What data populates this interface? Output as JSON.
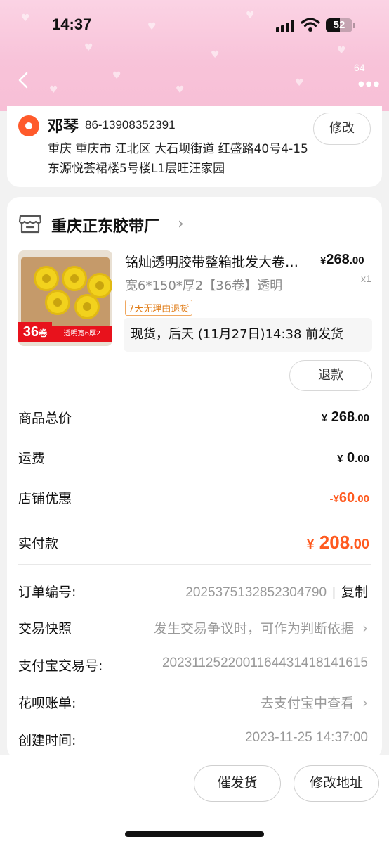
{
  "status_bar": {
    "time": "14:37",
    "battery": "52"
  },
  "header": {
    "more_badge": "64"
  },
  "address": {
    "name": "邓琴",
    "phone": "86-13908352391",
    "detail": "重庆 重庆市 江北区 大石坝街道 红盛路40号4-15东源悦荟裙楼5号楼L1层旺汪家园",
    "modify_label": "修改"
  },
  "store": {
    "name": "重庆正东胶带厂"
  },
  "product": {
    "title": "铭灿透明胶带整箱批发大卷宽胶带",
    "price_currency": "¥",
    "price_int": "268",
    "price_dec": ".00",
    "sku": "宽6*150*厚2【36卷】透明",
    "qty": "x1",
    "return_policy": "7天无理由退货",
    "image_tag_num": "36",
    "image_tag_unit": "卷",
    "image_tag_text": "透明宽6厚2",
    "shipping": "现货，后天 (11月27日)14:38 前发货",
    "refund_label": "退款"
  },
  "summary": {
    "total_label": "商品总价",
    "total_int": "268",
    "shipping_label": "运费",
    "shipping_int": "0",
    "discount_label": "店铺优惠",
    "discount_prefix": "-",
    "discount_int": "60",
    "paid_label": "实付款",
    "paid_int": "208",
    "currency": "¥",
    "dec": ".00"
  },
  "info": {
    "order_no_label": "订单编号:",
    "order_no": "2025375132852304790",
    "copy_label": "复制",
    "snapshot_label": "交易快照",
    "snapshot_value": "发生交易争议时，可作为判断依据",
    "alipay_label": "支付宝交易号:",
    "alipay_value": "2023112522001164431418141615",
    "huabei_label": "花呗账单:",
    "huabei_value": "去支付宝中查看",
    "created_label": "创建时间:",
    "created_value": "2023-11-25 14:37:00"
  },
  "actions": {
    "urge_label": "催发货",
    "change_address_label": "修改地址"
  },
  "colors": {
    "accent": "#ff5a1f",
    "header_pink": "#f8c3d9",
    "location_orange": "#ff5a2b"
  }
}
